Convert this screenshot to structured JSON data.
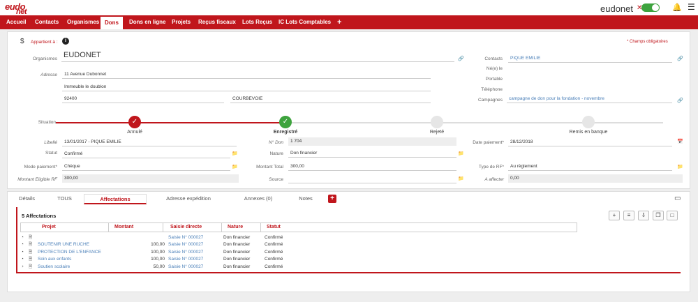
{
  "header": {
    "logo_top": "eudo",
    "logo_sub": "net",
    "brand": "eudonet",
    "brand_x": "✕",
    "bell_icon": "bell-icon",
    "menu_icon": "hamburger-menu-icon"
  },
  "nav": {
    "items": [
      "Accueil",
      "Contacts",
      "Organismes",
      "Dons",
      "Dons en ligne",
      "Projets",
      "Reçus fiscaux",
      "Lots Reçus",
      "IC Lots Comptables",
      "+"
    ],
    "active": "Dons"
  },
  "form": {
    "currency_icon": "$",
    "appartient_label": "Appartient à :",
    "info_icon": "info-icon",
    "required_note": "* Champs obligatoires",
    "organismes_label": "Organismes",
    "organismes_value": "EUDONET",
    "adresse_label": "Adresse",
    "adresse_1": "11 Avenue Dubonnet",
    "adresse_2": "Immeuble le doublon",
    "cp": "92400",
    "ville": "COURBEVOIE",
    "contacts_label": "Contacts",
    "contacts_value": "PIQUE EMILIE",
    "nele_label": "Né(e) le",
    "portable_label": "Portable",
    "telephone_label": "Téléphone",
    "campagnes_label": "Campagnes",
    "campagnes_value": "campagne de don pour la fondation - novembre",
    "situation_label": "Situation",
    "steps": [
      "Annulé",
      "Enregistré",
      "Rejeté",
      "Remis en banque"
    ],
    "libelle_label": "Libellé",
    "libelle_value": "13/01/2017 - PIQUE EMILIE",
    "statut_label": "Statut",
    "statut_value": "Confirmé",
    "mode_label": "Mode paiement*",
    "mode_value": "Chèque",
    "montant_elig_label": "Montant Eligible RF",
    "montant_elig_value": "300,00",
    "ndon_label": "N° Don",
    "ndon_value": "1 704",
    "nature_label": "Nature",
    "nature_value": "Don financier",
    "montant_total_label": "Montant Total",
    "montant_total_value": "300,00",
    "source_label": "Source",
    "date_paiement_label": "Date paiement*",
    "date_paiement_value": "28/12/2018",
    "type_rf_label": "Type de RF*",
    "type_rf_value": "Au règlement",
    "a_affecter_label": "A affecter",
    "a_affecter_value": "0,00"
  },
  "tabs": [
    "Détails",
    "TOUS",
    "Affectations",
    "Adresse expédition",
    "Annexes (0)",
    "Notes"
  ],
  "affectations": {
    "title": "5 Affectations",
    "columns": [
      "Projet",
      "Montant",
      "Saisie directe",
      "Nature",
      "Statut"
    ],
    "rows": [
      {
        "projet": "",
        "montant": "",
        "saisie": "Saisie N° 000027",
        "nature": "Don financier",
        "statut": "Confirmé"
      },
      {
        "projet": "SOUTENIR UNE RUCHE",
        "montant": "100,00",
        "saisie": "Saisie N° 000027",
        "nature": "Don financier",
        "statut": "Confirmé"
      },
      {
        "projet": "PROTECTION DE L'ENFANCE",
        "montant": "100,00",
        "saisie": "Saisie N° 000027",
        "nature": "Don financier",
        "statut": "Confirmé"
      },
      {
        "projet": "Soin aux enfants",
        "montant": "100,00",
        "saisie": "Saisie N° 000027",
        "nature": "Don financier",
        "statut": "Confirmé"
      },
      {
        "projet": "Soutien scolaire",
        "montant": "50,00",
        "saisie": "Saisie N° 000027",
        "nature": "Don financier",
        "statut": "Confirmé"
      }
    ]
  },
  "colors": {
    "brand_red": "#c0161c",
    "success_green": "#3ea33e",
    "link_blue": "#4a7fb8"
  }
}
